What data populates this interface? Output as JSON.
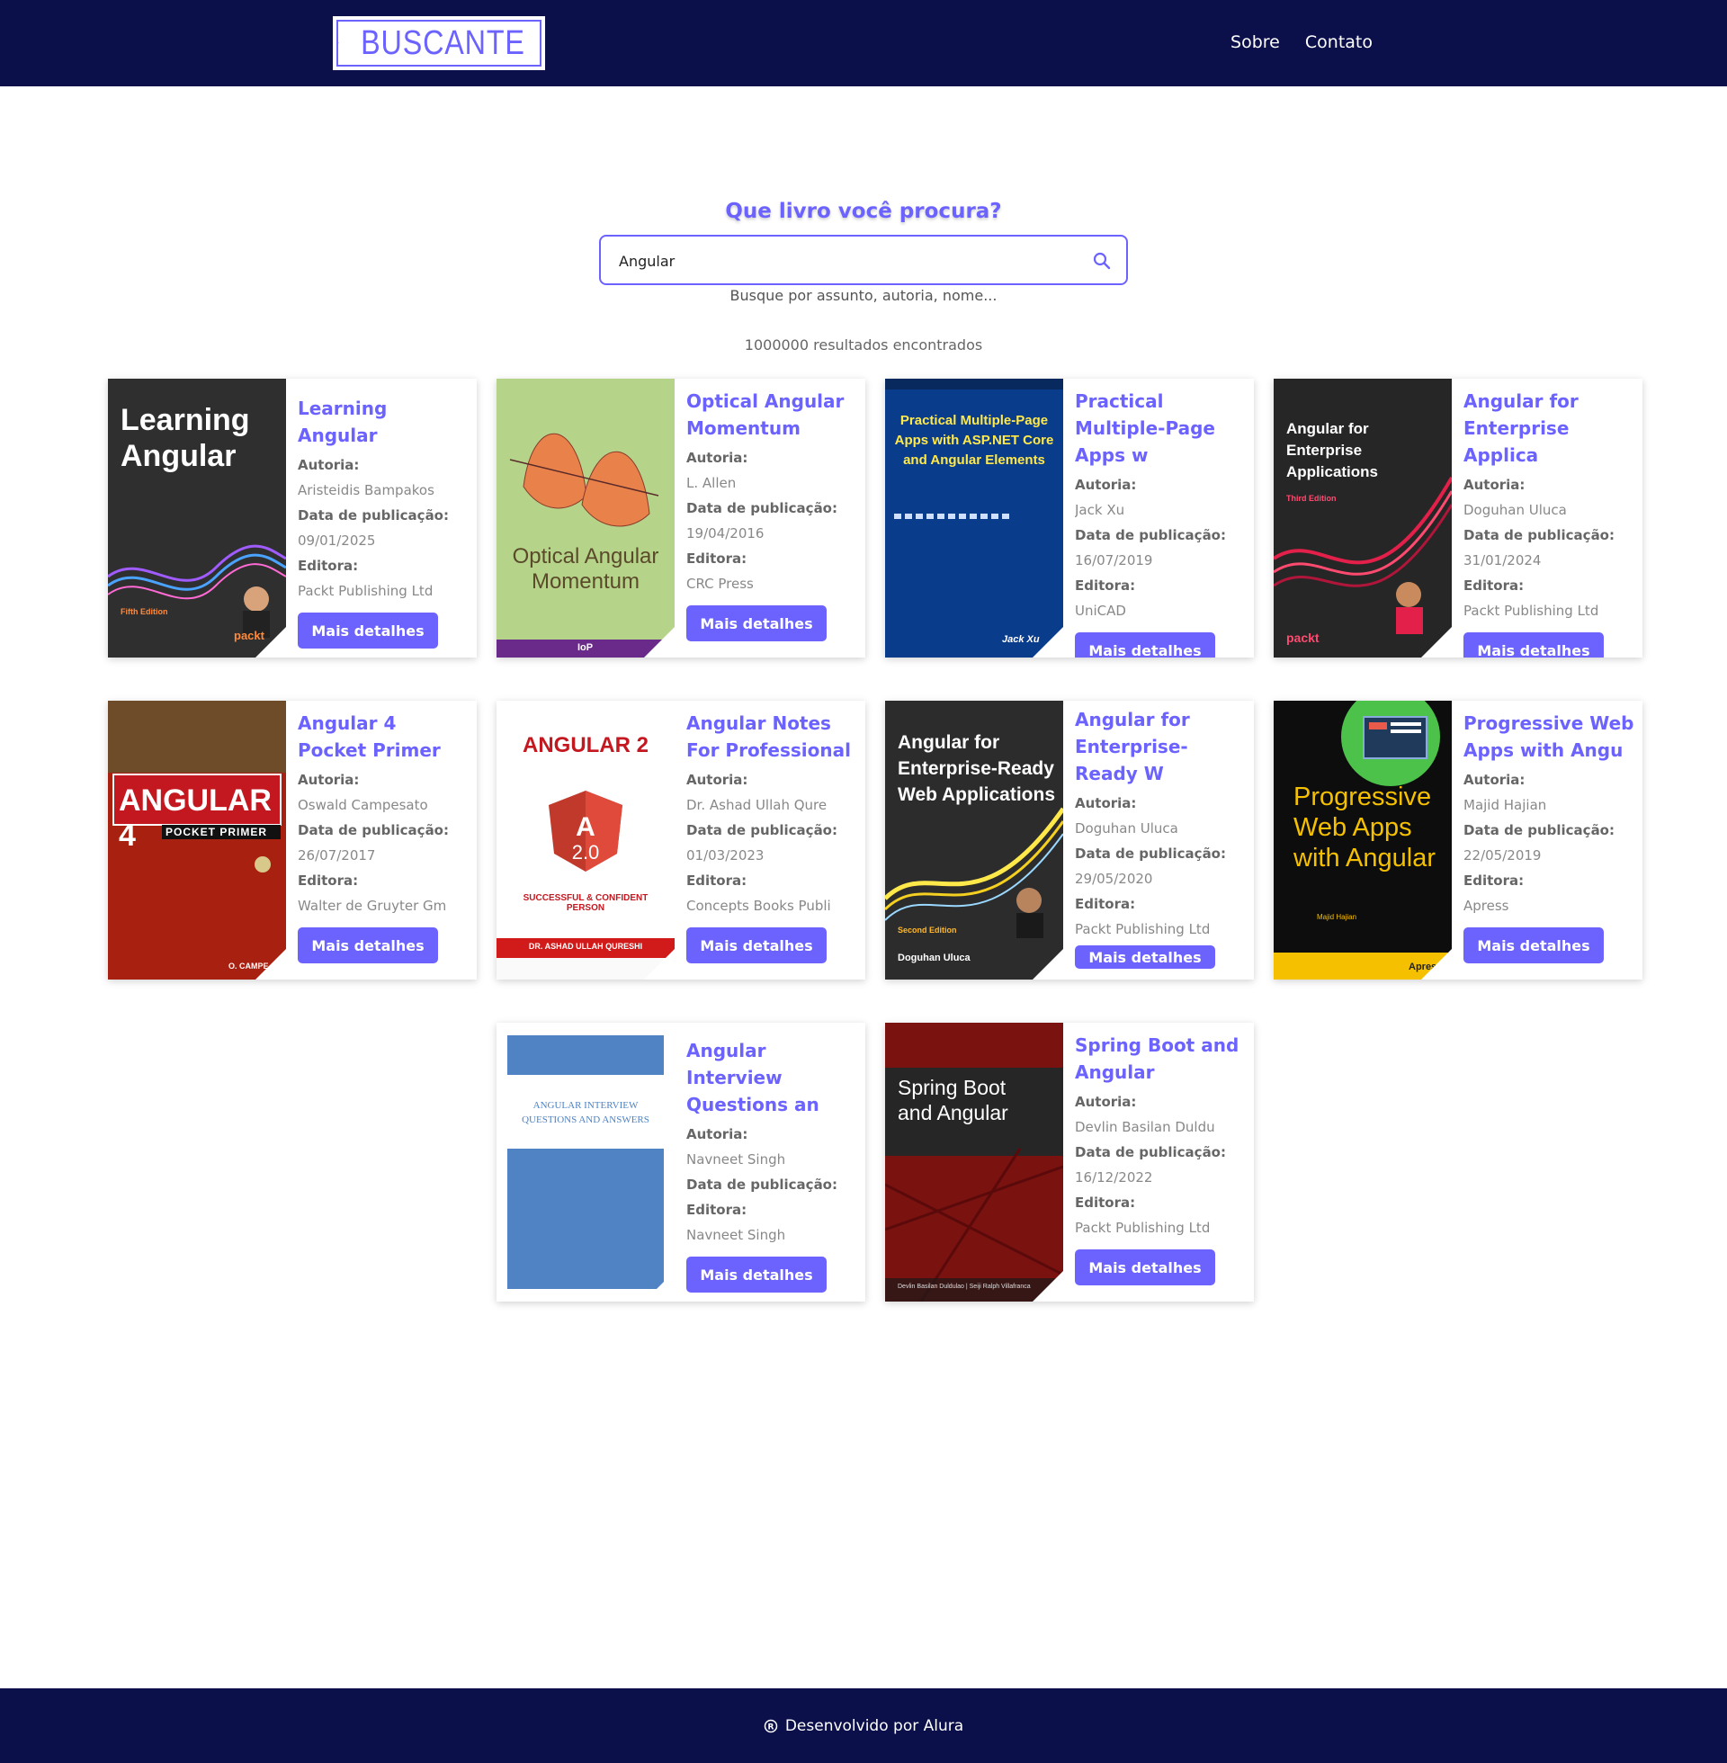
{
  "header": {
    "logo_text": "BUSCANTE",
    "nav": [
      "Sobre",
      "Contato"
    ]
  },
  "search": {
    "title": "Que livro você procura?",
    "value": "Angular",
    "hint": "Busque por assunto, autoria, nome...",
    "results": "1000000 resultados encontrados"
  },
  "labels": {
    "author": "Autoria:",
    "date": "Data de publicação:",
    "publisher": "Editora:",
    "button": "Mais detalhes"
  },
  "books": [
    {
      "title": "Learning Angular",
      "author": "Aristeidis Bampakos",
      "date": "09/01/2025",
      "publisher": "Packt Publishing Ltd",
      "cover": {
        "bg": "#2f2f2f",
        "main": "Learning Angular",
        "sub": "Fifth Edition",
        "brand": "packt"
      }
    },
    {
      "title": "Optical Angular Momentum",
      "author": "L. Allen",
      "date": "19/04/2016",
      "publisher": "CRC Press",
      "cover": {
        "bg": "#b5d48a",
        "main": "Optical Angular Momentum",
        "sub": "",
        "brand": "IoP"
      }
    },
    {
      "title": "Practical Multiple-Page Apps w",
      "author": "Jack Xu",
      "date": "16/07/2019",
      "publisher": "UniCAD",
      "cover": {
        "bg": "#0a3c8c",
        "main": "Practical Multiple-Page Apps with ASP.NET Core and Angular Elements",
        "sub": "",
        "brand": "Jack Xu"
      }
    },
    {
      "title": "Angular for Enterprise Applica",
      "author": "Doguhan Uluca",
      "date": "31/01/2024",
      "publisher": "Packt Publishing Ltd",
      "cover": {
        "bg": "#262626",
        "main": "Angular for Enterprise Applications",
        "sub": "Third Edition",
        "brand": "packt"
      }
    },
    {
      "title": "Angular 4 Pocket Primer",
      "author": "Oswald Campesato",
      "date": "26/07/2017",
      "publisher": "Walter de Gruyter Gm",
      "cover": {
        "bg": "#a8200f",
        "main": "ANGULAR 4",
        "sub": "POCKET PRIMER",
        "brand": "O. CAMPE"
      }
    },
    {
      "title": "Angular Notes For Professional",
      "author": "Dr. Ashad Ullah Qure",
      "date": "01/03/2023",
      "publisher": "Concepts Books Publi",
      "cover": {
        "bg": "#ffffff",
        "main": "ANGULAR 2",
        "sub": "SUCCESSFUL & CONFIDENT PERSON",
        "brand": "DR. ASHAD ULLAH QURESHI"
      }
    },
    {
      "title": "Angular for Enterprise-Ready W",
      "author": "Doguhan Uluca",
      "date": "29/05/2020",
      "publisher": "Packt Publishing Ltd",
      "cover": {
        "bg": "#2c2c2c",
        "main": "Angular for Enterprise-Ready Web Applications",
        "sub": "Second Edition",
        "brand": "Doguhan Uluca"
      }
    },
    {
      "title": "Progressive Web Apps with Angu",
      "author": "Majid Hajian",
      "date": "22/05/2019",
      "publisher": "Apress",
      "cover": {
        "bg": "#0d0d0d",
        "main": "Progressive Web Apps with Angular",
        "sub": "Majid Hajian",
        "brand": "Apress"
      }
    },
    {
      "title": "Angular Interview Questions an",
      "author": "Navneet Singh",
      "date": "",
      "publisher": "Navneet Singh",
      "cover": {
        "bg": "#ffffff",
        "main": "ANGULAR INTERVIEW QUESTIONS AND ANSWERS",
        "sub": "",
        "brand": ""
      }
    },
    {
      "title": "Spring Boot and Angular",
      "author": "Devlin Basilan Duldu",
      "date": "16/12/2022",
      "publisher": "Packt Publishing Ltd",
      "cover": {
        "bg": "#7a1210",
        "main": "Spring Boot and Angular",
        "sub": "Devlin Basilan Duldulao | Seiji Ralph Villafranca",
        "brand": ""
      }
    }
  ],
  "footer": {
    "text": "Desenvolvido por Alura"
  }
}
